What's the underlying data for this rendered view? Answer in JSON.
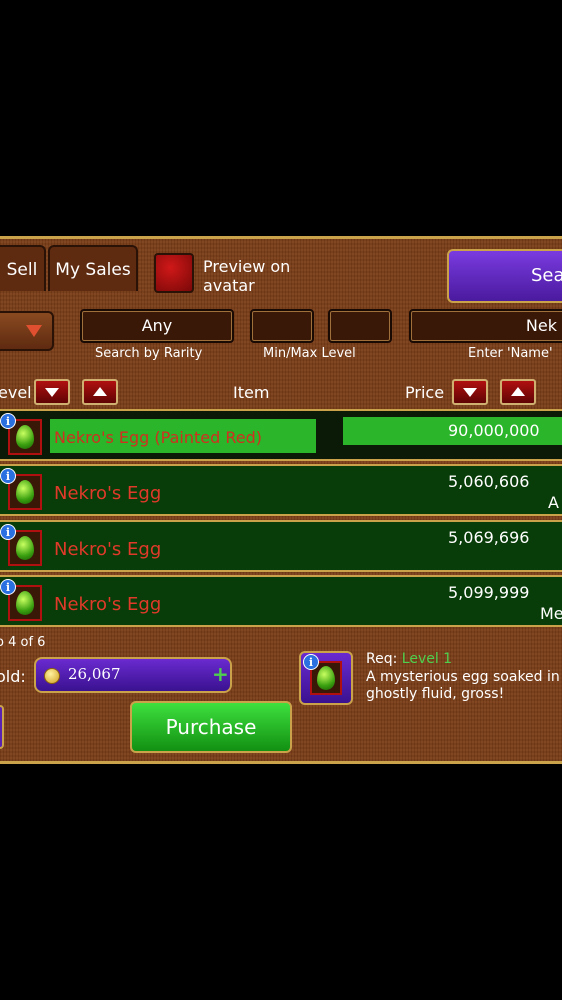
{
  "tabs": {
    "sell": "Sell",
    "my_sales": "My Sales"
  },
  "preview": {
    "label": "Preview on avatar"
  },
  "search_button": "Sear",
  "filters": {
    "rarity_value": "Any",
    "rarity_caption": "Search by Rarity",
    "level_caption": "Min/Max Level",
    "name_value": "Nek",
    "name_caption": "Enter 'Name'"
  },
  "columns": {
    "level": "evel",
    "item": "Item",
    "price": "Price"
  },
  "rows": [
    {
      "name": "Nekro's Egg (Painted Red)",
      "price": "90,000,000",
      "extra": ""
    },
    {
      "name": "Nekro's Egg",
      "price": "5,060,606",
      "extra": "A"
    },
    {
      "name": "Nekro's Egg",
      "price": "5,069,696",
      "extra": ""
    },
    {
      "name": "Nekro's Egg",
      "price": "5,099,999",
      "extra": "Me"
    }
  ],
  "pagination": "o 4 of 6",
  "gold": {
    "label": "old:",
    "amount": "26,067"
  },
  "purchase_button": "Purchase",
  "detail": {
    "req_label": "Req:",
    "req_value": "Level 1",
    "description": "A mysterious egg soaked in ghostly fluid, gross!"
  },
  "colors": {
    "accent_green": "#2ab52a",
    "accent_purple": "#5a22b0",
    "item_red": "#e03a2a"
  }
}
